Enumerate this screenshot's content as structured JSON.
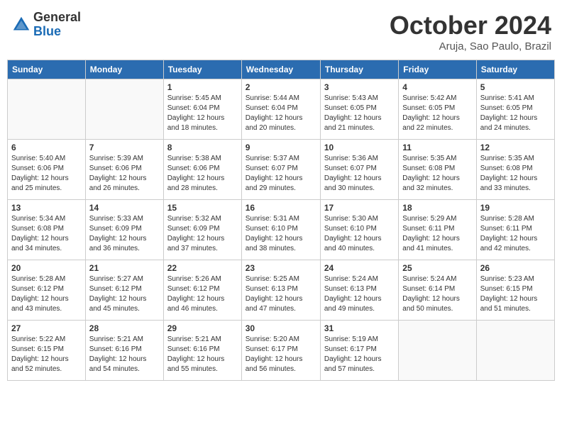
{
  "header": {
    "logo_general": "General",
    "logo_blue": "Blue",
    "month_title": "October 2024",
    "location": "Aruja, Sao Paulo, Brazil"
  },
  "weekdays": [
    "Sunday",
    "Monday",
    "Tuesday",
    "Wednesday",
    "Thursday",
    "Friday",
    "Saturday"
  ],
  "weeks": [
    [
      {
        "day": "",
        "info": ""
      },
      {
        "day": "",
        "info": ""
      },
      {
        "day": "1",
        "info": "Sunrise: 5:45 AM\nSunset: 6:04 PM\nDaylight: 12 hours\nand 18 minutes."
      },
      {
        "day": "2",
        "info": "Sunrise: 5:44 AM\nSunset: 6:04 PM\nDaylight: 12 hours\nand 20 minutes."
      },
      {
        "day": "3",
        "info": "Sunrise: 5:43 AM\nSunset: 6:05 PM\nDaylight: 12 hours\nand 21 minutes."
      },
      {
        "day": "4",
        "info": "Sunrise: 5:42 AM\nSunset: 6:05 PM\nDaylight: 12 hours\nand 22 minutes."
      },
      {
        "day": "5",
        "info": "Sunrise: 5:41 AM\nSunset: 6:05 PM\nDaylight: 12 hours\nand 24 minutes."
      }
    ],
    [
      {
        "day": "6",
        "info": "Sunrise: 5:40 AM\nSunset: 6:06 PM\nDaylight: 12 hours\nand 25 minutes."
      },
      {
        "day": "7",
        "info": "Sunrise: 5:39 AM\nSunset: 6:06 PM\nDaylight: 12 hours\nand 26 minutes."
      },
      {
        "day": "8",
        "info": "Sunrise: 5:38 AM\nSunset: 6:06 PM\nDaylight: 12 hours\nand 28 minutes."
      },
      {
        "day": "9",
        "info": "Sunrise: 5:37 AM\nSunset: 6:07 PM\nDaylight: 12 hours\nand 29 minutes."
      },
      {
        "day": "10",
        "info": "Sunrise: 5:36 AM\nSunset: 6:07 PM\nDaylight: 12 hours\nand 30 minutes."
      },
      {
        "day": "11",
        "info": "Sunrise: 5:35 AM\nSunset: 6:08 PM\nDaylight: 12 hours\nand 32 minutes."
      },
      {
        "day": "12",
        "info": "Sunrise: 5:35 AM\nSunset: 6:08 PM\nDaylight: 12 hours\nand 33 minutes."
      }
    ],
    [
      {
        "day": "13",
        "info": "Sunrise: 5:34 AM\nSunset: 6:08 PM\nDaylight: 12 hours\nand 34 minutes."
      },
      {
        "day": "14",
        "info": "Sunrise: 5:33 AM\nSunset: 6:09 PM\nDaylight: 12 hours\nand 36 minutes."
      },
      {
        "day": "15",
        "info": "Sunrise: 5:32 AM\nSunset: 6:09 PM\nDaylight: 12 hours\nand 37 minutes."
      },
      {
        "day": "16",
        "info": "Sunrise: 5:31 AM\nSunset: 6:10 PM\nDaylight: 12 hours\nand 38 minutes."
      },
      {
        "day": "17",
        "info": "Sunrise: 5:30 AM\nSunset: 6:10 PM\nDaylight: 12 hours\nand 40 minutes."
      },
      {
        "day": "18",
        "info": "Sunrise: 5:29 AM\nSunset: 6:11 PM\nDaylight: 12 hours\nand 41 minutes."
      },
      {
        "day": "19",
        "info": "Sunrise: 5:28 AM\nSunset: 6:11 PM\nDaylight: 12 hours\nand 42 minutes."
      }
    ],
    [
      {
        "day": "20",
        "info": "Sunrise: 5:28 AM\nSunset: 6:12 PM\nDaylight: 12 hours\nand 43 minutes."
      },
      {
        "day": "21",
        "info": "Sunrise: 5:27 AM\nSunset: 6:12 PM\nDaylight: 12 hours\nand 45 minutes."
      },
      {
        "day": "22",
        "info": "Sunrise: 5:26 AM\nSunset: 6:12 PM\nDaylight: 12 hours\nand 46 minutes."
      },
      {
        "day": "23",
        "info": "Sunrise: 5:25 AM\nSunset: 6:13 PM\nDaylight: 12 hours\nand 47 minutes."
      },
      {
        "day": "24",
        "info": "Sunrise: 5:24 AM\nSunset: 6:13 PM\nDaylight: 12 hours\nand 49 minutes."
      },
      {
        "day": "25",
        "info": "Sunrise: 5:24 AM\nSunset: 6:14 PM\nDaylight: 12 hours\nand 50 minutes."
      },
      {
        "day": "26",
        "info": "Sunrise: 5:23 AM\nSunset: 6:15 PM\nDaylight: 12 hours\nand 51 minutes."
      }
    ],
    [
      {
        "day": "27",
        "info": "Sunrise: 5:22 AM\nSunset: 6:15 PM\nDaylight: 12 hours\nand 52 minutes."
      },
      {
        "day": "28",
        "info": "Sunrise: 5:21 AM\nSunset: 6:16 PM\nDaylight: 12 hours\nand 54 minutes."
      },
      {
        "day": "29",
        "info": "Sunrise: 5:21 AM\nSunset: 6:16 PM\nDaylight: 12 hours\nand 55 minutes."
      },
      {
        "day": "30",
        "info": "Sunrise: 5:20 AM\nSunset: 6:17 PM\nDaylight: 12 hours\nand 56 minutes."
      },
      {
        "day": "31",
        "info": "Sunrise: 5:19 AM\nSunset: 6:17 PM\nDaylight: 12 hours\nand 57 minutes."
      },
      {
        "day": "",
        "info": ""
      },
      {
        "day": "",
        "info": ""
      }
    ]
  ]
}
